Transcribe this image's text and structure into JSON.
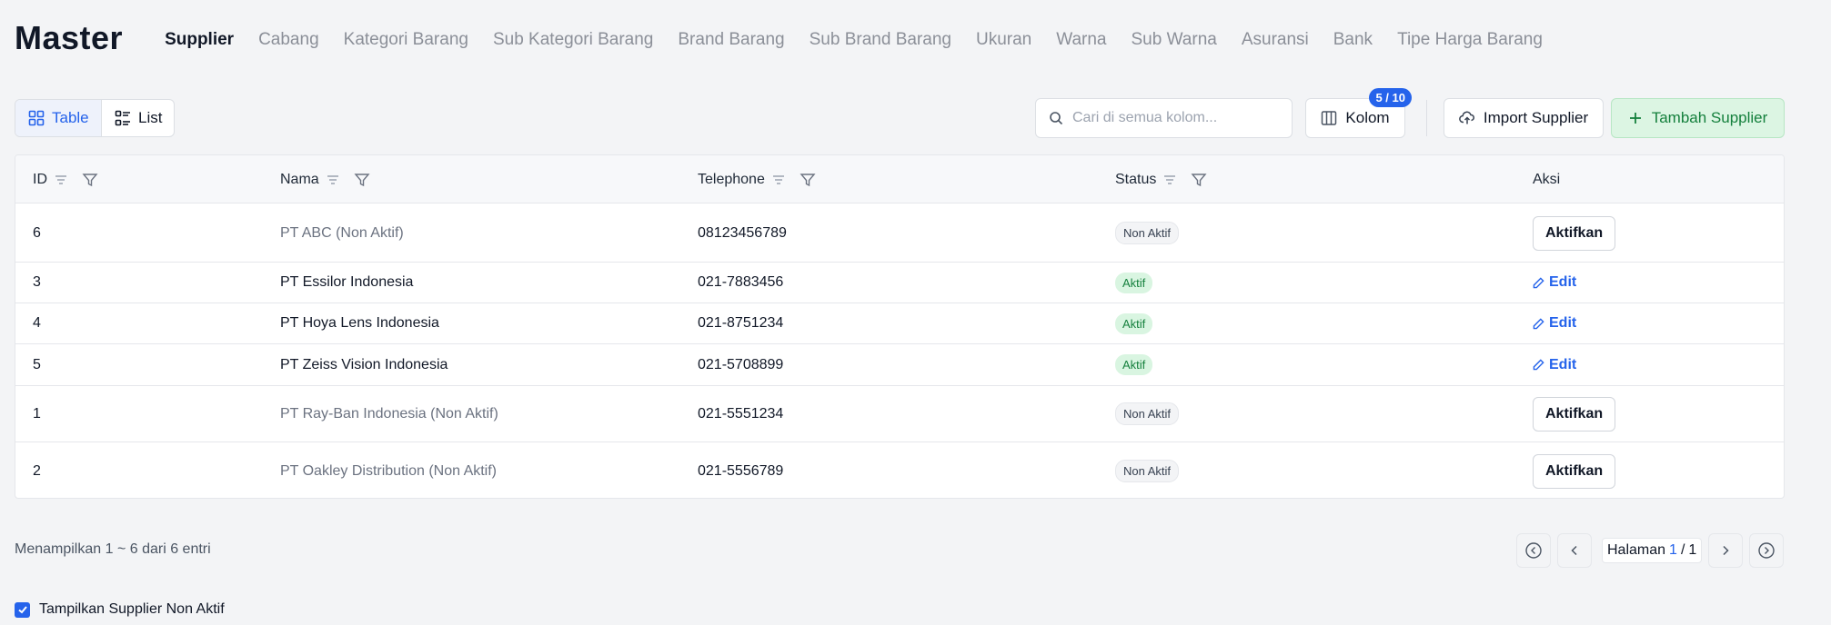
{
  "header": {
    "title": "Master",
    "tabs": [
      {
        "label": "Supplier",
        "active": true
      },
      {
        "label": "Cabang"
      },
      {
        "label": "Kategori Barang"
      },
      {
        "label": "Sub Kategori Barang"
      },
      {
        "label": "Brand Barang"
      },
      {
        "label": "Sub Brand Barang"
      },
      {
        "label": "Ukuran"
      },
      {
        "label": "Warna"
      },
      {
        "label": "Sub Warna"
      },
      {
        "label": "Asuransi"
      },
      {
        "label": "Bank"
      },
      {
        "label": "Tipe Harga Barang"
      }
    ]
  },
  "toolbar": {
    "view_table_label": "Table",
    "view_list_label": "List",
    "search_placeholder": "Cari di semua kolom...",
    "kolom_label": "Kolom",
    "kolom_badge": "5 / 10",
    "import_label": "Import Supplier",
    "tambah_label": "Tambah Supplier"
  },
  "table": {
    "columns": [
      "ID",
      "Nama",
      "Telephone",
      "Status",
      "Aksi"
    ],
    "rows": [
      {
        "id": "6",
        "nama": "PT ABC (Non Aktif)",
        "telephone": "08123456789",
        "status": "Non Aktif",
        "aksi": "Aktifkan"
      },
      {
        "id": "3",
        "nama": "PT Essilor Indonesia",
        "telephone": "021-7883456",
        "status": "Aktif",
        "aksi": "Edit"
      },
      {
        "id": "4",
        "nama": "PT Hoya Lens Indonesia",
        "telephone": "021-8751234",
        "status": "Aktif",
        "aksi": "Edit"
      },
      {
        "id": "5",
        "nama": "PT Zeiss Vision Indonesia",
        "telephone": "021-5708899",
        "status": "Aktif",
        "aksi": "Edit"
      },
      {
        "id": "1",
        "nama": "PT Ray-Ban Indonesia (Non Aktif)",
        "telephone": "021-5551234",
        "status": "Non Aktif",
        "aksi": "Aktifkan"
      },
      {
        "id": "2",
        "nama": "PT Oakley Distribution (Non Aktif)",
        "telephone": "021-5556789",
        "status": "Non Aktif",
        "aksi": "Aktifkan"
      }
    ]
  },
  "footer": {
    "entries_text": "Menampilkan 1 ~ 6 dari 6 entri",
    "page_label": "Halaman",
    "page_current": "1",
    "page_sep": "/",
    "page_total": "1",
    "show_inactive_label": "Tampilkan Supplier Non Aktif",
    "show_inactive_checked": true
  },
  "colors": {
    "accent": "#2563eb",
    "success_bg": "#dcf5e3",
    "success_text": "#15803d"
  },
  "icons": {
    "table_view": "grid-icon",
    "list_view": "list-icon",
    "search": "search-icon",
    "kolom": "columns-icon",
    "import": "cloud-upload-icon",
    "tambah": "plus-icon",
    "sort": "sort-icon",
    "filter": "filter-icon",
    "edit": "pencil-icon"
  }
}
